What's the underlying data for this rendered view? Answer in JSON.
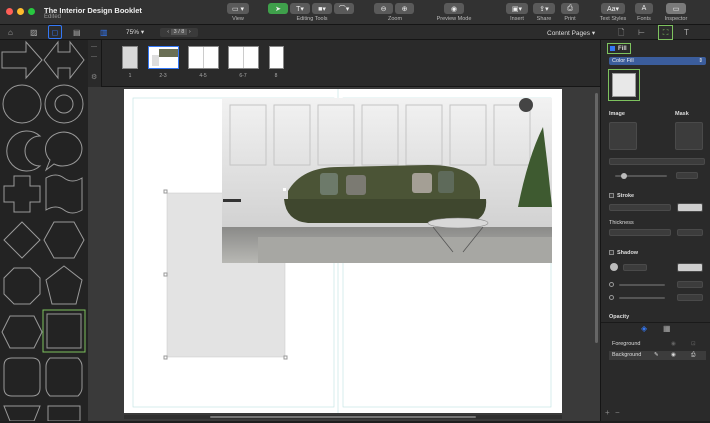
{
  "window": {
    "title": "The Interior Design Booklet",
    "subtitle": "Edited"
  },
  "toolbar": {
    "view": "View",
    "editing_tools": "Editing Tools",
    "zoom": "Zoom",
    "preview_mode": "Preview Mode",
    "insert": "Insert",
    "share": "Share",
    "print": "Print",
    "text_styles": "Text Styles",
    "fonts": "Fonts",
    "inspector": "Inspector"
  },
  "subbar": {
    "zoom_level": "75%",
    "page_indicator": "3 / 8",
    "content_pages": "Content Pages"
  },
  "pages": [
    {
      "label": "1"
    },
    {
      "label": "2-3"
    },
    {
      "label": "4-5"
    },
    {
      "label": "6-7"
    },
    {
      "label": "8"
    }
  ],
  "inspector": {
    "fill_label": "Fill",
    "fill_type": "Color Fill",
    "image_label": "Image",
    "mask_label": "Mask",
    "stroke_label": "Stroke",
    "thickness_label": "Thickness",
    "shadow_label": "Shadow",
    "opacity_label": "Opacity"
  },
  "layers": [
    {
      "name": "Foreground"
    },
    {
      "name": "Background"
    }
  ],
  "colors": {
    "accent_green": "#7dc25e",
    "accent_blue": "#3478f6",
    "sofa": "#4b5436"
  }
}
